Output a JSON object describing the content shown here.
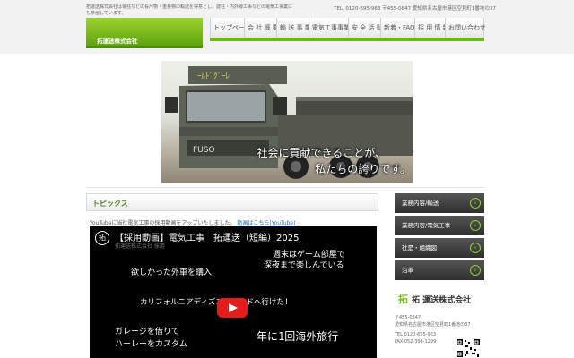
{
  "header": {
    "intro": "拓運送株式会社は電柱などの長尺物・重量物の輸送を得意とし、建柱・内外線工事などの電気工事業にも参画しています。",
    "contact": "TEL. 0120-695-963 〒455-0847 愛知県名古屋市港区空見町1番地の37",
    "logo_text": "拓運送株式会社"
  },
  "nav": {
    "items": [
      {
        "label": "トップページ"
      },
      {
        "label": "会 社 概 要"
      },
      {
        "label": "輸 送 事 業"
      },
      {
        "label": "電気工事事業"
      },
      {
        "label": "安 全 活 動"
      },
      {
        "label": "新着・FAQ"
      },
      {
        "label": "採 用 情 報"
      },
      {
        "label": "お問い合わせ"
      }
    ]
  },
  "hero": {
    "line1": "社会に貢献できることが、",
    "line2": "私たちの誇りです。"
  },
  "topics": {
    "title": "トピックス",
    "news_text": "YouTubeに当社電気工事の採用動画をアップいたしました。",
    "news_link": "動画はこちら(YouTube)"
  },
  "video": {
    "badge": "拓",
    "title": "【採用動画】電気工事　拓運送（短編）2025",
    "subtitle": "拓運送株式会社 採用",
    "lines": [
      "週末はゲーム部屋で",
      "深夜まで楽しんでいる",
      "欲しかった外車を購入",
      "カリフォルニアディズニーランドへ行けた!",
      "ガレージを借りて",
      "ハーレーをカスタム",
      "年に1回海外旅行"
    ]
  },
  "sidebar": {
    "items": [
      {
        "label": "業務内容/輸送"
      },
      {
        "label": "業務内容/電気工事"
      },
      {
        "label": "社是・組織図"
      },
      {
        "label": "沿革"
      }
    ],
    "arrow": "›"
  },
  "company": {
    "mark": "拓",
    "name": "拓 運送株式会社",
    "postal": "〒455-0847",
    "address": "愛知県名古屋市港区空見町1番地の37",
    "tel": "TEL 0120-695-963",
    "fax": "FAX 052-398-1299"
  },
  "colors": {
    "accent_green": "#6cb51a",
    "play_red": "#e31c1c"
  }
}
